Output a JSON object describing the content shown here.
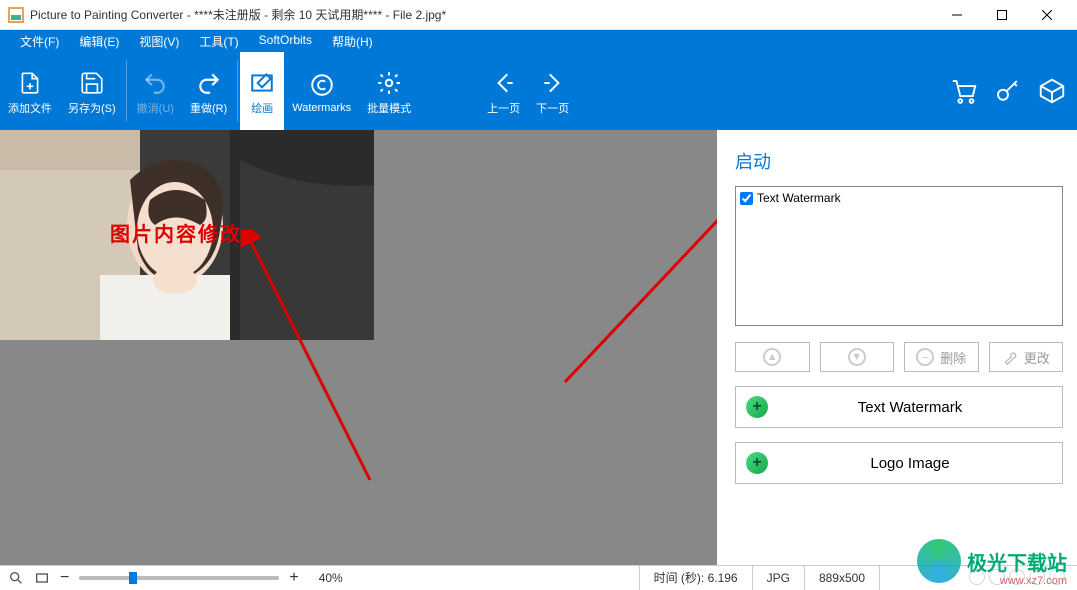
{
  "window": {
    "title": "Picture to Painting Converter - ****未注册版 - 剩余 10 天试用期**** - File 2.jpg*"
  },
  "menu": {
    "file": "文件(F)",
    "edit": "编辑(E)",
    "view": "视图(V)",
    "tools": "工具(T)",
    "softorbits": "SoftOrbits",
    "help": "帮助(H)"
  },
  "toolbar": {
    "add_file": "添加文件",
    "save_as": "另存为(S)",
    "undo": "撤消(U)",
    "redo": "重做(R)",
    "paint": "绘画",
    "watermarks": "Watermarks",
    "batch": "批量模式",
    "prev": "上一页",
    "next": "下一页"
  },
  "canvas": {
    "watermark_text": "图片内容修改"
  },
  "side": {
    "title": "启动",
    "list": {
      "item0": "Text Watermark"
    },
    "delete": "删除",
    "modify": "更改",
    "text_watermark": "Text Watermark",
    "logo_image": "Logo Image"
  },
  "status": {
    "zoom": "40%",
    "time": "时间 (秒): 6.196",
    "format": "JPG",
    "dimensions": "889x500"
  },
  "brand": {
    "text": "极光下载站",
    "url": "www.xz7.com"
  }
}
